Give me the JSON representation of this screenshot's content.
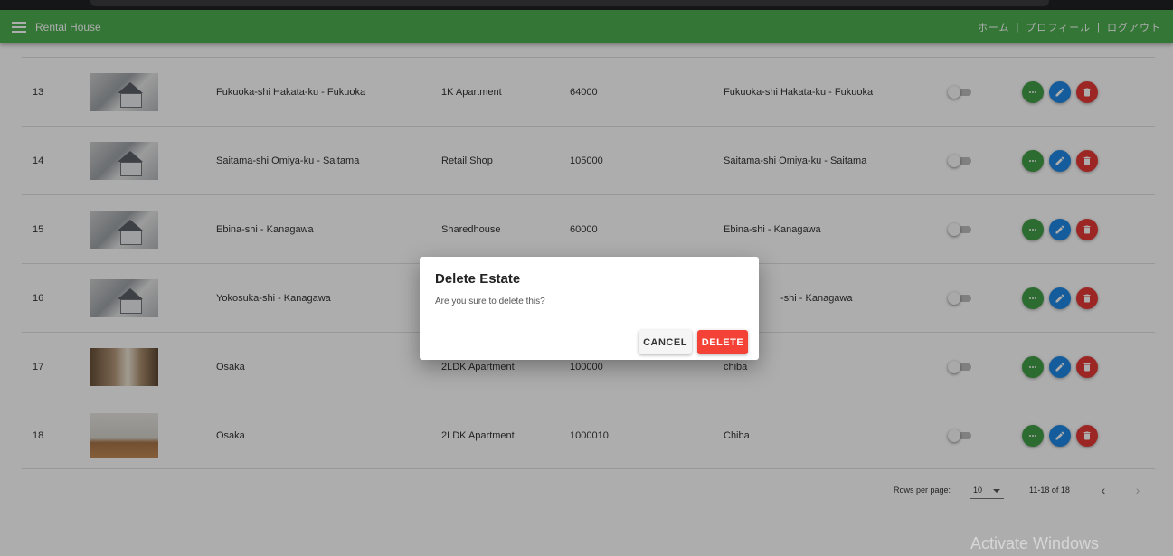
{
  "app": {
    "title": "Rental House"
  },
  "nav": {
    "home": "ホーム",
    "profile": "プロフィール",
    "logout": "ログアウト",
    "sep": "|"
  },
  "rows": [
    {
      "id": "13",
      "image": "house-model-photo",
      "name": "Fukuoka-shi Hakata-ku - Fukuoka",
      "type": "1K Apartment",
      "price": "64000",
      "address": "Fukuoka-shi Hakata-ku - Fukuoka",
      "active": false
    },
    {
      "id": "14",
      "image": "house-model-photo",
      "name": "Saitama-shi Omiya-ku - Saitama",
      "type": "Retail Shop",
      "price": "105000",
      "address": "Saitama-shi Omiya-ku - Saitama",
      "active": false
    },
    {
      "id": "15",
      "image": "house-model-photo",
      "name": "Ebina-shi - Kanagawa",
      "type": "Sharedhouse",
      "price": "60000",
      "address": "Ebina-shi - Kanagawa",
      "active": false
    },
    {
      "id": "16",
      "image": "house-model-photo",
      "name": "Yokosuka-shi - Kanagawa",
      "type": "",
      "price": "",
      "address": "-shi - Kanagawa",
      "active": false
    },
    {
      "id": "17",
      "image": "room-photo",
      "name": "Osaka",
      "type": "2LDK Apartment",
      "price": "100000",
      "address": "chiba",
      "active": false
    },
    {
      "id": "18",
      "image": "room-photo",
      "name": "Osaka",
      "type": "2LDK Apartment",
      "price": "1000010",
      "address": "Chiba",
      "active": false
    }
  ],
  "pagination": {
    "rows_per_page_label": "Rows per page:",
    "rows_per_page": "10",
    "range": "11-18 of 18",
    "prev_icon": "chevron-left-icon",
    "next_icon": "chevron-right-icon"
  },
  "dialog": {
    "title": "Delete Estate",
    "message": "Are you sure to delete this?",
    "cancel_label": "CANCEL",
    "delete_label": "DELETE"
  },
  "icons": {
    "view": "more-horiz-icon",
    "edit": "pencil-icon",
    "delete": "trash-icon"
  },
  "colors": {
    "appbar": "#4caf50",
    "view_button": "#43a047",
    "edit_button": "#1e88e5",
    "delete_button": "#e53935",
    "dialog_delete": "#f44336"
  },
  "watermark": "Activate Windows"
}
